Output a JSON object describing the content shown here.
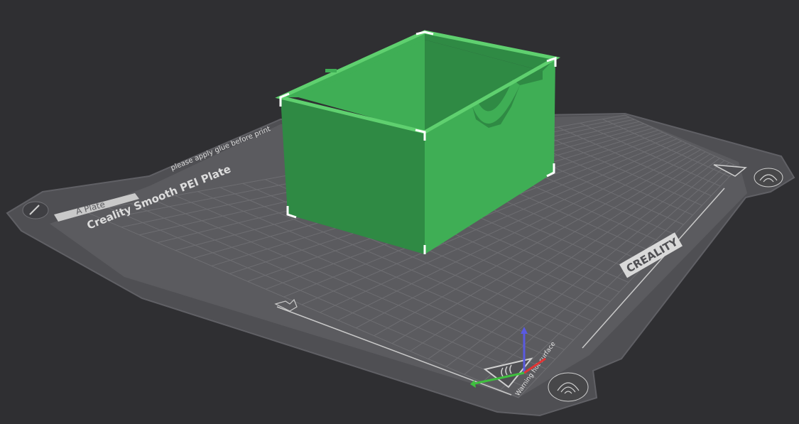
{
  "viewport": {
    "background": "#2f2f32"
  },
  "plate": {
    "name_tab": "A Plate",
    "title": "Creality Smooth PEI Plate",
    "glue_note": "please apply glue before print",
    "brand": "CREALITY",
    "hot_warning": "Warning hot surface",
    "heat_icon": "hot-surface-warning-icon",
    "fingerprint_icon": "fingerprint-icon",
    "edit_icon": "pencil-icon",
    "colors": {
      "bed": "#5b5b5f",
      "bed_dark": "#4b4b4f",
      "grid": "#6d6d71",
      "text": "#d8d8d8"
    }
  },
  "model": {
    "name": "box-with-finger-notch",
    "color": "#3fae55",
    "color_dark": "#2f8a44",
    "outline": "#ffffff"
  },
  "axes": {
    "x_color": "#e03434",
    "y_color": "#3fbf3f",
    "z_color": "#5a5ae0"
  }
}
